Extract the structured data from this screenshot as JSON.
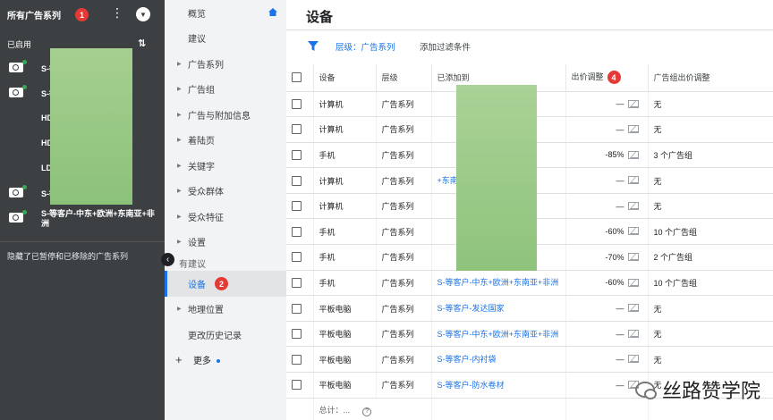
{
  "left_panel": {
    "title": "所有广告系列",
    "title_badge": "1",
    "section_label": "已启用",
    "campaigns": [
      {
        "text": "S-等",
        "icon": "search-campaign-icon",
        "dot": true
      },
      {
        "text": "S-等",
        "icon": "search-campaign-icon",
        "dot": true
      },
      {
        "text": "HD",
        "icon": "",
        "dot": false
      },
      {
        "text": "HD",
        "icon": "",
        "dot": false
      },
      {
        "text": "LD",
        "icon": "",
        "dot": false
      },
      {
        "text": "S-等",
        "icon": "search-campaign-icon",
        "dot": true
      },
      {
        "text": "S-等客户-中东+欧洲+东南亚+非洲",
        "icon": "search-campaign-icon",
        "dot": true
      }
    ],
    "hidden_note": "隐藏了已暂停和已移除的广告系列"
  },
  "nav": {
    "items": [
      {
        "label": "概览",
        "arrow": false,
        "home": true
      },
      {
        "label": "建议",
        "arrow": false
      },
      {
        "label": "广告系列",
        "arrow": true
      },
      {
        "label": "广告组",
        "arrow": true
      },
      {
        "label": "广告与附加信息",
        "arrow": true
      },
      {
        "label": "着陆页",
        "arrow": true
      },
      {
        "label": "关键字",
        "arrow": true
      },
      {
        "label": "受众群体",
        "arrow": true
      },
      {
        "label": "受众特征",
        "arrow": true
      },
      {
        "label": "设置",
        "arrow": true
      }
    ],
    "section": "有建议",
    "active": {
      "label": "设备",
      "badge": "2"
    },
    "after": [
      {
        "label": "地理位置",
        "arrow": true
      },
      {
        "label": "更改历史记录",
        "arrow": false
      }
    ],
    "more": "更多"
  },
  "main": {
    "title": "设备",
    "filter": {
      "chip": "层级：广告系列",
      "add": "添加过滤条件"
    },
    "columns": [
      "设备",
      "层级",
      "已添加到",
      "出价调整",
      "广告组出价调整"
    ],
    "bid_badge": "4",
    "rows": [
      {
        "device": "计算机",
        "level": "广告系列",
        "added": "",
        "bid": "—",
        "group_bid": "无"
      },
      {
        "device": "计算机",
        "level": "广告系列",
        "added": "",
        "bid": "—",
        "group_bid": "无"
      },
      {
        "device": "手机",
        "level": "广告系列",
        "added": "",
        "bid": "-85%",
        "group_bid": "3 个广告组"
      },
      {
        "device": "计算机",
        "level": "广告系列",
        "added": "+东南亚",
        "bid": "—",
        "group_bid": "无"
      },
      {
        "device": "计算机",
        "level": "广告系列",
        "added": "",
        "bid": "—",
        "group_bid": "无"
      },
      {
        "device": "手机",
        "level": "广告系列",
        "added": "",
        "bid": "-60%",
        "group_bid": "10 个广告组"
      },
      {
        "device": "手机",
        "level": "广告系列",
        "added": "",
        "bid": "-70%",
        "group_bid": "2 个广告组"
      },
      {
        "device": "手机",
        "level": "广告系列",
        "added": "S-等客户-中东+欧洲+东南亚+非洲",
        "bid": "-60%",
        "group_bid": "10 个广告组"
      },
      {
        "device": "平板电脑",
        "level": "广告系列",
        "added": "S-等客户-发达国家",
        "bid": "—",
        "group_bid": "无"
      },
      {
        "device": "平板电脑",
        "level": "广告系列",
        "added": "S-等客户-中东+欧洲+东南亚+非洲",
        "bid": "—",
        "group_bid": "无"
      },
      {
        "device": "平板电脑",
        "level": "广告系列",
        "added": "S-等客户-内衬袋",
        "bid": "—",
        "group_bid": "无"
      },
      {
        "device": "平板电脑",
        "level": "广告系列",
        "added": "S-等客户-防水卷材",
        "bid": "—",
        "group_bid": "无"
      }
    ],
    "total": "总计：..."
  },
  "watermark": "丝路赞学院",
  "colors": {
    "accent": "#1a73e8",
    "badge": "#e53935",
    "sidebar": "#3c4043",
    "redaction": "#9ccb87"
  }
}
